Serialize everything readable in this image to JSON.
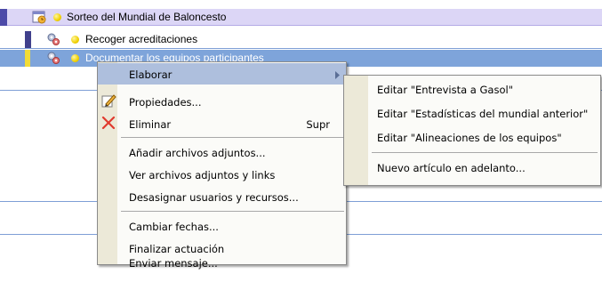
{
  "tree": {
    "rows": [
      {
        "label": "Sorteo del Mundial de Baloncesto"
      },
      {
        "label": "Recoger acreditaciones"
      },
      {
        "label": "Documentar los equipos participantes"
      }
    ]
  },
  "context_menu": {
    "items": [
      {
        "label": "Elaborar",
        "has_submenu": true
      },
      {
        "label": "Propiedades...",
        "icon": "edit-icon"
      },
      {
        "label": "Eliminar",
        "shortcut": "Supr",
        "icon": "delete-icon"
      },
      {
        "label": "Añadir archivos adjuntos..."
      },
      {
        "label": "Ver archivos adjuntos y links"
      },
      {
        "label": "Desasignar usuarios y recursos..."
      },
      {
        "label": "Cambiar fechas..."
      },
      {
        "label": "Finalizar actuación"
      },
      {
        "label": "Enviar mensaje..."
      }
    ]
  },
  "submenu": {
    "items": [
      {
        "label": "Editar \"Entrevista a Gasol\""
      },
      {
        "label": "Editar \"Estadísticas del mundial anterior\""
      },
      {
        "label": "Editar \"Alineaciones de los equipos\""
      },
      {
        "label": "Nuevo artículo en adelanto..."
      }
    ]
  },
  "colors": {
    "row1_bg": "#dcd6f6",
    "selected_bg": "#7ea4da",
    "highlight_bg": "#aebfdd",
    "line": "#7f9fd6",
    "menu_gutter": "#ece9d8",
    "delete_red": "#e03a2e"
  }
}
